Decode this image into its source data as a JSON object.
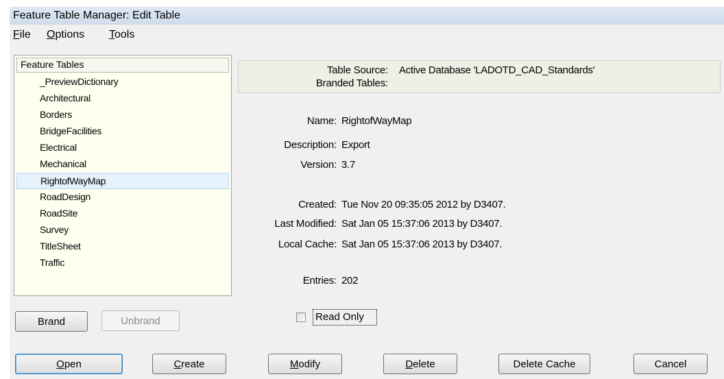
{
  "window": {
    "title": "Feature Table Manager: Edit Table"
  },
  "menu": [
    {
      "mnemonic": "F",
      "rest": "ile"
    },
    {
      "mnemonic": "O",
      "rest": "ptions"
    },
    {
      "mnemonic": "T",
      "rest": "ools"
    }
  ],
  "feature_tables": {
    "header": "Feature Tables",
    "selected": "RightofWayMap",
    "items": [
      "_PreviewDictionary",
      "Architectural",
      "Borders",
      "BridgeFacilities",
      "Electrical",
      "Mechanical",
      "RightofWayMap",
      "RoadDesign",
      "RoadSite",
      "Survey",
      "TitleSheet",
      "Traffic"
    ]
  },
  "source": {
    "table_source_label": "Table Source:",
    "table_source_value": "Active Database 'LADOTD_CAD_Standards'",
    "branded_tables_label": "Branded Tables:"
  },
  "details": {
    "name_label": "Name:",
    "name_value": "RightofWayMap",
    "description_label": "Description:",
    "description_value": "Export",
    "version_label": "Version:",
    "version_value": "3.7",
    "created_label": "Created:",
    "created_value": "Tue Nov 20 09:35:05 2012 by D3407.",
    "last_modified_label": "Last Modified:",
    "last_modified_value": "Sat Jan 05 15:37:06 2013 by D3407.",
    "local_cache_label": "Local Cache:",
    "local_cache_value": "Sat Jan 05 15:37:06 2013 by D3407.",
    "entries_label": "Entries:",
    "entries_value": "202"
  },
  "read_only": {
    "label": "Read Only",
    "checked": false
  },
  "buttons": {
    "brand": "Brand",
    "unbrand": "Unbrand",
    "open": {
      "mnemonic": "O",
      "rest": "pen"
    },
    "create": {
      "mnemonic": "C",
      "rest": "reate"
    },
    "modify": {
      "mnemonic": "M",
      "rest": "odify"
    },
    "delete": {
      "mnemonic": "D",
      "rest": "elete"
    },
    "delete_cache": "Delete Cache",
    "cancel": "Cancel"
  }
}
